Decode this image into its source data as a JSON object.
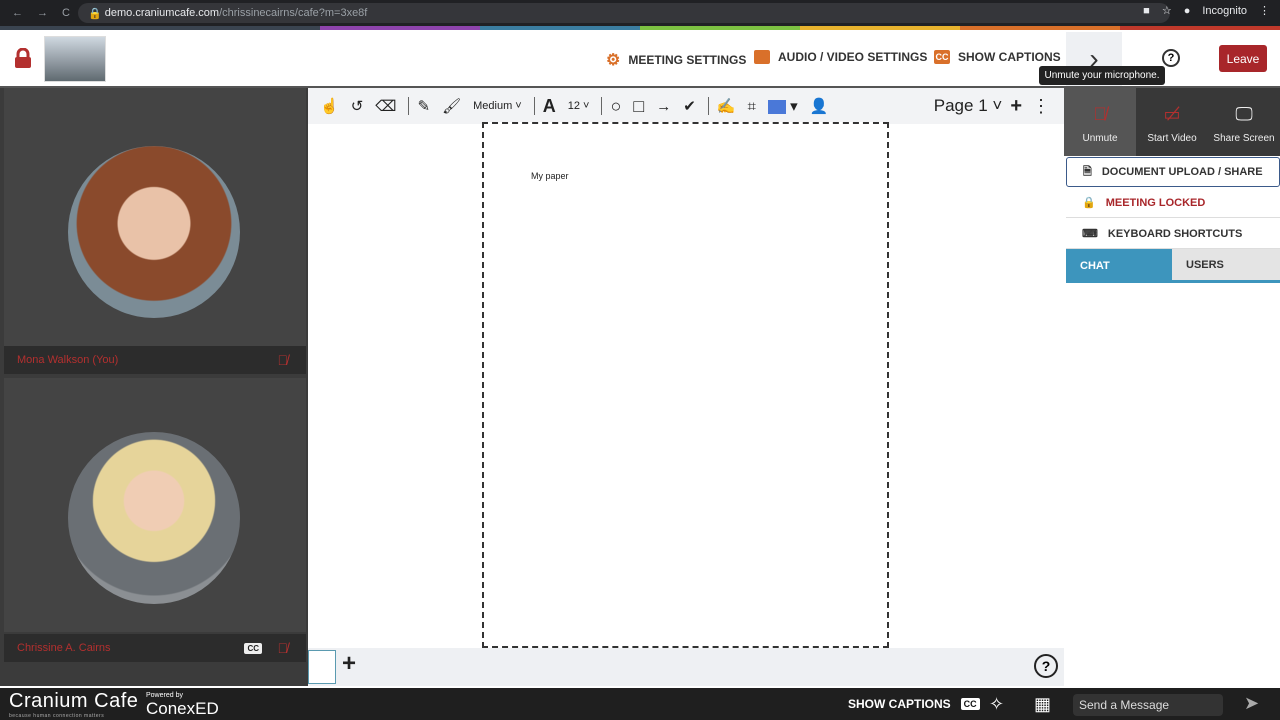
{
  "browser": {
    "url_host": "demo.craniumcafe.com",
    "url_path": "/chrissinecairns/cafe?m=3xe8f",
    "profile_label": "Incognito"
  },
  "header": {
    "meeting_settings": "MEETING SETTINGS",
    "audio_video_settings": "AUDIO / VIDEO SETTINGS",
    "show_captions": "SHOW CAPTIONS",
    "leave": "Leave",
    "tooltip": "Unmute your microphone."
  },
  "participants": [
    {
      "name": "Mona Walkson (You)",
      "muted": true
    },
    {
      "name": "Chrissine A. Cairns",
      "muted": true,
      "captions": "CC"
    }
  ],
  "whiteboard": {
    "pen_size": "Medium",
    "font_size": "12",
    "page_label": "Page 1",
    "color": "#4a78d8",
    "paper_text": "My paper"
  },
  "sidebar": {
    "media": [
      {
        "label": "Unmute",
        "icon": "mic-off-icon"
      },
      {
        "label": "Start Video",
        "icon": "video-off-icon"
      },
      {
        "label": "Share Screen",
        "icon": "share-screen-icon"
      }
    ],
    "menu": [
      {
        "label": "DOCUMENT UPLOAD / SHARE",
        "icon": "document-icon"
      },
      {
        "label": "MEETING LOCKED",
        "icon": "lock-icon"
      },
      {
        "label": "KEYBOARD SHORTCUTS",
        "icon": "keyboard-icon"
      }
    ],
    "tabs": [
      {
        "label": "CHAT",
        "active": true
      },
      {
        "label": "USERS",
        "active": false
      }
    ]
  },
  "footer": {
    "brand": "Cranium Cafe",
    "tagline": "because human connection matters",
    "powered_by": "Powered by",
    "partner": "ConexED",
    "show_captions": "SHOW CAPTIONS",
    "cc": "CC",
    "message_placeholder": "Send a Message"
  }
}
